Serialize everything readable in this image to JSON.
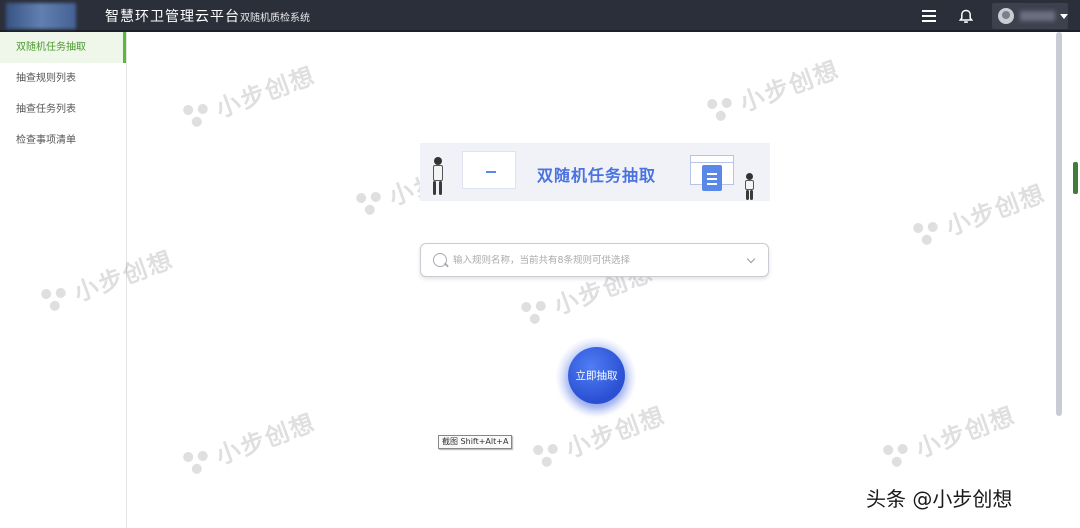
{
  "header": {
    "title": "智慧环卫管理云平台",
    "subtitle": "双随机质检系统",
    "menu_icon": "hamburger-menu-icon",
    "bell_icon": "bell-icon",
    "avatar_icon": "user-avatar-icon",
    "caret_icon": "caret-down-icon"
  },
  "sidebar": {
    "items": [
      {
        "label": "双随机任务抽取",
        "active": true
      },
      {
        "label": "抽查规则列表",
        "active": false
      },
      {
        "label": "抽查任务列表",
        "active": false
      },
      {
        "label": "检查事项清单",
        "active": false
      }
    ]
  },
  "banner": {
    "title": "双随机任务抽取"
  },
  "search": {
    "placeholder": "输入规则名称，当前共有8条规则可供选择"
  },
  "draw_button": {
    "label": "立即抽取"
  },
  "tooltip": {
    "text": "截图 Shift+Alt+A"
  },
  "watermark": {
    "text": "小步创想"
  },
  "credit": {
    "text": "头条 @小步创想"
  },
  "colors": {
    "header_bg": "#2b2f3a",
    "active_green": "#5cb83c",
    "accent_blue": "#4a73e0",
    "button_blue": "#2a4fd2"
  }
}
